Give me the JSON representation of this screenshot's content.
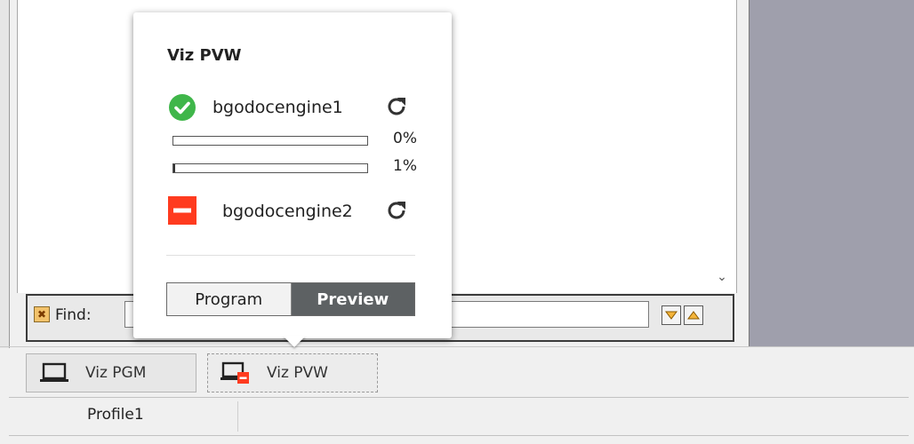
{
  "popover": {
    "title": "Viz PVW",
    "engines": [
      {
        "name": "bgodocengine1",
        "status": "ok",
        "status_color": "#3fb64a"
      },
      {
        "name": "bgodocengine2",
        "status": "error",
        "status_color": "#ff3b1f"
      }
    ],
    "progress": [
      {
        "label": "0%",
        "value": 0
      },
      {
        "label": "1%",
        "value": 1
      }
    ],
    "toggle": {
      "program_label": "Program",
      "preview_label": "Preview",
      "selected": "Preview"
    }
  },
  "findbar": {
    "label": "Find:",
    "value": ""
  },
  "tabs": [
    {
      "label": "Viz PGM",
      "icon": "laptop-icon"
    },
    {
      "label": "Viz PVW",
      "icon": "laptop-error-icon"
    }
  ],
  "statusbar": {
    "profile": "Profile1"
  },
  "colors": {
    "accent_dark": "#5d6163",
    "right_panel": "#9f9fac",
    "error": "#ff3b1f",
    "ok": "#3fb64a"
  }
}
